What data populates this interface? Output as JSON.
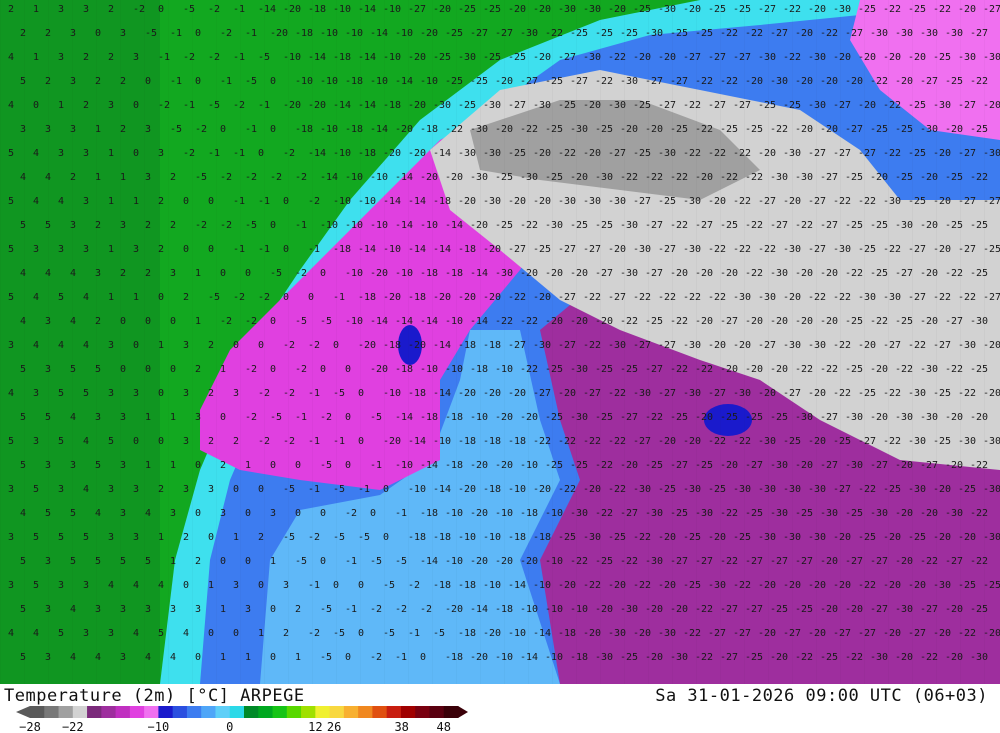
{
  "title": {
    "variable": "Temperature (2m) [°C] ARPEGE",
    "datetime": "Sa 31-01-2026 09:00 UTC (06+03)"
  },
  "colorbar": {
    "tick_labels": [
      "−28",
      "−22",
      "−10",
      "0",
      "12",
      "26",
      "38",
      "48"
    ],
    "stops": [
      {
        "value": -28,
        "color": "#5a5a5a"
      },
      {
        "value": -26,
        "color": "#787878"
      },
      {
        "value": -24,
        "color": "#a0a0a0"
      },
      {
        "value": -22,
        "color": "#d2d2d2"
      },
      {
        "value": -20,
        "color": "#7b2a7b"
      },
      {
        "value": -18,
        "color": "#9e2e9e"
      },
      {
        "value": -16,
        "color": "#c030c0"
      },
      {
        "value": -14,
        "color": "#e040e0"
      },
      {
        "value": -12,
        "color": "#f070f0"
      },
      {
        "value": -10,
        "color": "#1a1acc"
      },
      {
        "value": -8,
        "color": "#2b4fe0"
      },
      {
        "value": -6,
        "color": "#3d7cf0"
      },
      {
        "value": -4,
        "color": "#4fa6f8"
      },
      {
        "value": -2,
        "color": "#5fcff8"
      },
      {
        "value": 0,
        "color": "#2bd9e8"
      },
      {
        "value": 2,
        "color": "#008a28"
      },
      {
        "value": 4,
        "color": "#00a820"
      },
      {
        "value": 6,
        "color": "#16c416"
      },
      {
        "value": 8,
        "color": "#58d800"
      },
      {
        "value": 10,
        "color": "#a0e000"
      },
      {
        "value": 12,
        "color": "#f0f030"
      },
      {
        "value": 16,
        "color": "#f8d840"
      },
      {
        "value": 20,
        "color": "#f8b030"
      },
      {
        "value": 24,
        "color": "#f08820"
      },
      {
        "value": 28,
        "color": "#e05010"
      },
      {
        "value": 32,
        "color": "#c81e10"
      },
      {
        "value": 36,
        "color": "#a00000"
      },
      {
        "value": 40,
        "color": "#7a0010"
      },
      {
        "value": 44,
        "color": "#5a0010"
      },
      {
        "value": 48,
        "color": "#3a0008"
      }
    ]
  },
  "map": {
    "region": "Scandinavia",
    "sample_labels": [
      "5",
      "4",
      "3",
      "2",
      "1",
      "0",
      "-1",
      "-2",
      "-5",
      "-10",
      "-14",
      "-18",
      "-20",
      "-22",
      "-25",
      "-27",
      "-30"
    ]
  }
}
